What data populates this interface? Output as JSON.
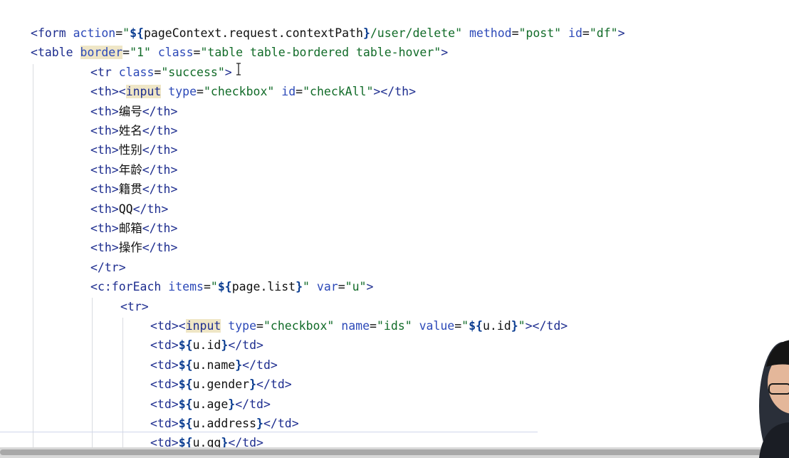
{
  "code": {
    "lines": [
      [
        {
          "t": "<",
          "c": "tag"
        },
        {
          "t": "form",
          "c": "tag"
        },
        {
          "t": " ",
          "c": "plain"
        },
        {
          "t": "action",
          "c": "attr"
        },
        {
          "t": "=",
          "c": "plain"
        },
        {
          "t": "\"",
          "c": "str"
        },
        {
          "t": "${",
          "c": "el"
        },
        {
          "t": "pageContext.request.contextPath",
          "c": "plain"
        },
        {
          "t": "}",
          "c": "el"
        },
        {
          "t": "/user/delete\"",
          "c": "str"
        },
        {
          "t": " ",
          "c": "plain"
        },
        {
          "t": "method",
          "c": "attr"
        },
        {
          "t": "=",
          "c": "plain"
        },
        {
          "t": "\"post\"",
          "c": "str"
        },
        {
          "t": " ",
          "c": "plain"
        },
        {
          "t": "id",
          "c": "attr"
        },
        {
          "t": "=",
          "c": "plain"
        },
        {
          "t": "\"df\"",
          "c": "str"
        },
        {
          "t": ">",
          "c": "tag"
        }
      ],
      [
        {
          "t": "<",
          "c": "tag"
        },
        {
          "t": "table",
          "c": "tag"
        },
        {
          "t": " ",
          "c": "plain"
        },
        {
          "t": "border",
          "c": "attr",
          "hl": true
        },
        {
          "t": "=",
          "c": "plain"
        },
        {
          "t": "\"1\"",
          "c": "str"
        },
        {
          "t": " ",
          "c": "plain"
        },
        {
          "t": "class",
          "c": "attr"
        },
        {
          "t": "=",
          "c": "plain"
        },
        {
          "t": "\"table table-bordered table-hover\"",
          "c": "str"
        },
        {
          "t": ">",
          "c": "tag"
        }
      ],
      [
        {
          "t": "<",
          "c": "tag"
        },
        {
          "t": "tr",
          "c": "tag"
        },
        {
          "t": " ",
          "c": "plain"
        },
        {
          "t": "class",
          "c": "attr"
        },
        {
          "t": "=",
          "c": "plain"
        },
        {
          "t": "\"success\"",
          "c": "str"
        },
        {
          "t": ">",
          "c": "tag"
        }
      ],
      [
        {
          "t": "<",
          "c": "tag"
        },
        {
          "t": "th",
          "c": "tag"
        },
        {
          "t": ">",
          "c": "tag"
        },
        {
          "t": "<",
          "c": "tag"
        },
        {
          "t": "input",
          "c": "tag",
          "hl": true
        },
        {
          "t": " ",
          "c": "plain"
        },
        {
          "t": "type",
          "c": "attr"
        },
        {
          "t": "=",
          "c": "plain"
        },
        {
          "t": "\"checkbox\"",
          "c": "str"
        },
        {
          "t": " ",
          "c": "plain"
        },
        {
          "t": "id",
          "c": "attr"
        },
        {
          "t": "=",
          "c": "plain"
        },
        {
          "t": "\"checkAll\"",
          "c": "str"
        },
        {
          "t": "></",
          "c": "tag"
        },
        {
          "t": "th",
          "c": "tag"
        },
        {
          "t": ">",
          "c": "tag"
        }
      ],
      [
        {
          "t": "<th>",
          "c": "tag"
        },
        {
          "t": "编号",
          "c": "plain"
        },
        {
          "t": "</th>",
          "c": "tag"
        }
      ],
      [
        {
          "t": "<th>",
          "c": "tag"
        },
        {
          "t": "姓名",
          "c": "plain"
        },
        {
          "t": "</th>",
          "c": "tag"
        }
      ],
      [
        {
          "t": "<th>",
          "c": "tag"
        },
        {
          "t": "性别",
          "c": "plain"
        },
        {
          "t": "</th>",
          "c": "tag"
        }
      ],
      [
        {
          "t": "<th>",
          "c": "tag"
        },
        {
          "t": "年龄",
          "c": "plain"
        },
        {
          "t": "</th>",
          "c": "tag"
        }
      ],
      [
        {
          "t": "<th>",
          "c": "tag"
        },
        {
          "t": "籍贯",
          "c": "plain"
        },
        {
          "t": "</th>",
          "c": "tag"
        }
      ],
      [
        {
          "t": "<th>",
          "c": "tag"
        },
        {
          "t": "QQ",
          "c": "plain"
        },
        {
          "t": "</th>",
          "c": "tag"
        }
      ],
      [
        {
          "t": "<th>",
          "c": "tag"
        },
        {
          "t": "邮箱",
          "c": "plain"
        },
        {
          "t": "</th>",
          "c": "tag"
        }
      ],
      [
        {
          "t": "<th>",
          "c": "tag"
        },
        {
          "t": "操作",
          "c": "plain"
        },
        {
          "t": "</th>",
          "c": "tag"
        }
      ],
      [
        {
          "t": "</tr>",
          "c": "tag"
        }
      ],
      [
        {
          "t": "<",
          "c": "tag"
        },
        {
          "t": "c:forEach",
          "c": "tag"
        },
        {
          "t": " ",
          "c": "plain"
        },
        {
          "t": "items",
          "c": "attr"
        },
        {
          "t": "=",
          "c": "plain"
        },
        {
          "t": "\"",
          "c": "str"
        },
        {
          "t": "${",
          "c": "el"
        },
        {
          "t": "page.list",
          "c": "plain"
        },
        {
          "t": "}",
          "c": "el"
        },
        {
          "t": "\"",
          "c": "str"
        },
        {
          "t": " ",
          "c": "plain"
        },
        {
          "t": "var",
          "c": "attr"
        },
        {
          "t": "=",
          "c": "plain"
        },
        {
          "t": "\"u\"",
          "c": "str"
        },
        {
          "t": ">",
          "c": "tag"
        }
      ],
      [
        {
          "t": "<tr>",
          "c": "tag"
        }
      ],
      [
        {
          "t": "<",
          "c": "tag"
        },
        {
          "t": "td",
          "c": "tag"
        },
        {
          "t": ">",
          "c": "tag"
        },
        {
          "t": "<",
          "c": "tag"
        },
        {
          "t": "input",
          "c": "tag",
          "hl": true
        },
        {
          "t": " ",
          "c": "plain"
        },
        {
          "t": "type",
          "c": "attr"
        },
        {
          "t": "=",
          "c": "plain"
        },
        {
          "t": "\"checkbox\"",
          "c": "str"
        },
        {
          "t": " ",
          "c": "plain"
        },
        {
          "t": "name",
          "c": "attr"
        },
        {
          "t": "=",
          "c": "plain"
        },
        {
          "t": "\"ids\"",
          "c": "str"
        },
        {
          "t": " ",
          "c": "plain"
        },
        {
          "t": "value",
          "c": "attr"
        },
        {
          "t": "=",
          "c": "plain"
        },
        {
          "t": "\"",
          "c": "str"
        },
        {
          "t": "${",
          "c": "el"
        },
        {
          "t": "u.id",
          "c": "plain"
        },
        {
          "t": "}",
          "c": "el"
        },
        {
          "t": "\"",
          "c": "str"
        },
        {
          "t": "></",
          "c": "tag"
        },
        {
          "t": "td",
          "c": "tag"
        },
        {
          "t": ">",
          "c": "tag"
        }
      ],
      [
        {
          "t": "<td>",
          "c": "tag"
        },
        {
          "t": "${",
          "c": "el"
        },
        {
          "t": "u.id",
          "c": "plain"
        },
        {
          "t": "}",
          "c": "el"
        },
        {
          "t": "</td>",
          "c": "tag"
        }
      ],
      [
        {
          "t": "<td>",
          "c": "tag"
        },
        {
          "t": "${",
          "c": "el"
        },
        {
          "t": "u.name",
          "c": "plain"
        },
        {
          "t": "}",
          "c": "el"
        },
        {
          "t": "</td>",
          "c": "tag"
        }
      ],
      [
        {
          "t": "<td>",
          "c": "tag"
        },
        {
          "t": "${",
          "c": "el"
        },
        {
          "t": "u.gender",
          "c": "plain"
        },
        {
          "t": "}",
          "c": "el"
        },
        {
          "t": "</td>",
          "c": "tag"
        }
      ],
      [
        {
          "t": "<td>",
          "c": "tag"
        },
        {
          "t": "${",
          "c": "el"
        },
        {
          "t": "u.age",
          "c": "plain"
        },
        {
          "t": "}",
          "c": "el"
        },
        {
          "t": "</td>",
          "c": "tag"
        }
      ],
      [
        {
          "t": "<td>",
          "c": "tag"
        },
        {
          "t": "${",
          "c": "el"
        },
        {
          "t": "u.address",
          "c": "plain"
        },
        {
          "t": "}",
          "c": "el"
        },
        {
          "t": "</td>",
          "c": "tag"
        }
      ],
      [
        {
          "t": "<td>",
          "c": "tag"
        },
        {
          "t": "${",
          "c": "el"
        },
        {
          "t": "u.qq",
          "c": "plain"
        },
        {
          "t": "}",
          "c": "el"
        },
        {
          "t": "</td>",
          "c": "tag"
        }
      ]
    ]
  },
  "icons": {
    "caret": "text-cursor-icon"
  },
  "colors": {
    "tag": "#1d2d8f",
    "attribute": "#2c49b8",
    "string": "#116b28",
    "el_brace": "#0b3d91",
    "match_highlight": "#efe6c6"
  }
}
